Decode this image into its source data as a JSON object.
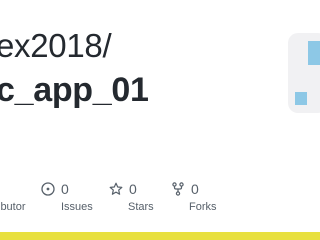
{
  "repo": {
    "owner": "ex2018/",
    "name": "c_app_01"
  },
  "stats": {
    "contributors": {
      "label": "ibutor"
    },
    "issues": {
      "count": "0",
      "label": "Issues"
    },
    "stars": {
      "count": "0",
      "label": "Stars"
    },
    "forks": {
      "count": "0",
      "label": "Forks"
    }
  },
  "colors": {
    "text": "#24292f",
    "muted": "#57606a",
    "avatar_pixel": "#8dc8e6",
    "language_bar": "#e8e03f"
  },
  "icons": {
    "issues": "issue-circle-icon",
    "stars": "star-icon",
    "forks": "fork-icon"
  }
}
